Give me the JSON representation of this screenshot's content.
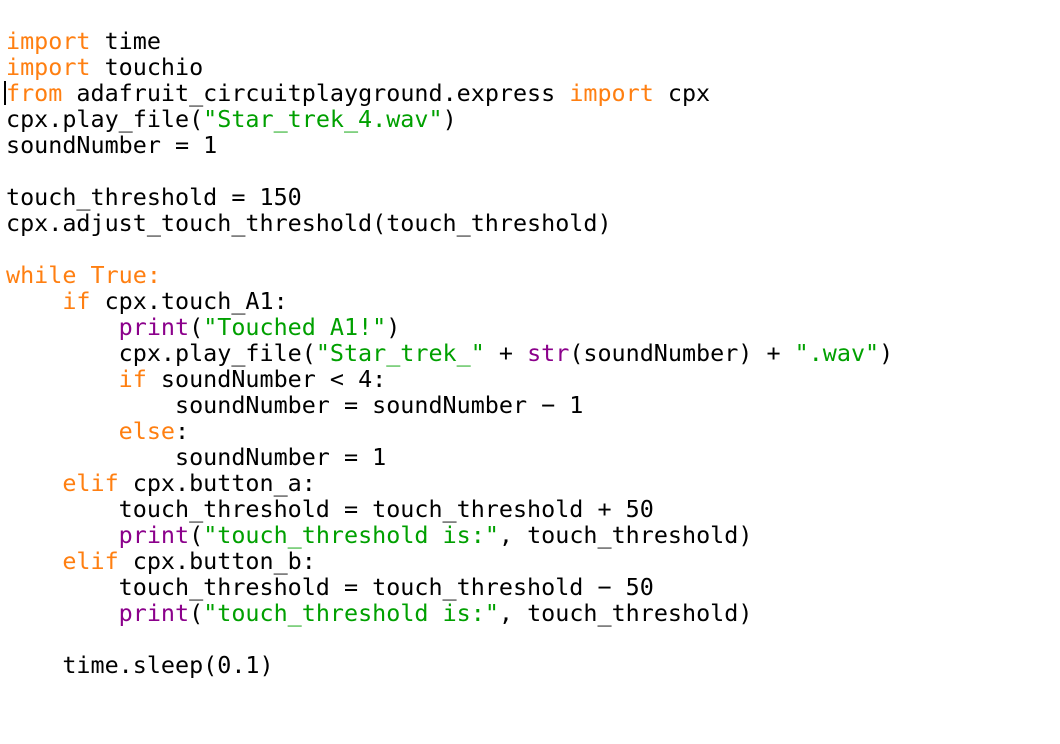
{
  "editor": {
    "language": "python",
    "caret_line_index": 2,
    "caret_column": 0,
    "colors": {
      "background": "#ffffff",
      "foreground": "#000000",
      "keyword": "#ff7f11",
      "string": "#00a000",
      "builtin": "#8b008b",
      "caret": "#000000"
    },
    "plain_text": "import time\nimport touchio\nfrom adafruit_circuitplayground.express import cpx\ncpx.play_file(\"Star_trek_4.wav\")\nsoundNumber = 1\n\ntouch_threshold = 150\ncpx.adjust_touch_threshold(touch_threshold)\n\nwhile True:\n    if cpx.touch_A1:\n        print(\"Touched A1!\")\n        cpx.play_file(\"Star_trek_\" + str(soundNumber) + \".wav\")\n        if soundNumber < 4:\n            soundNumber = soundNumber - 1\n        else:\n            soundNumber = 1\n    elif cpx.button_a:\n        touch_threshold = touch_threshold + 50\n        print(\"touch_threshold is:\", touch_threshold)\n    elif cpx.button_b:\n        touch_threshold = touch_threshold - 50\n        print(\"touch_threshold is:\", touch_threshold)\n\n    time.sleep(0.1)\n",
    "lines": [
      {
        "index": 0,
        "tokens": [
          {
            "t": "import",
            "k": "kw"
          },
          {
            "t": " time",
            "k": "plain"
          }
        ]
      },
      {
        "index": 1,
        "tokens": [
          {
            "t": "import",
            "k": "kw"
          },
          {
            "t": " touchio",
            "k": "plain"
          }
        ]
      },
      {
        "index": 2,
        "tokens": [
          {
            "t": "from",
            "k": "kw"
          },
          {
            "t": " adafruit_circuitplayground.express ",
            "k": "plain"
          },
          {
            "t": "import",
            "k": "kw"
          },
          {
            "t": " cpx",
            "k": "plain"
          }
        ]
      },
      {
        "index": 3,
        "tokens": [
          {
            "t": "cpx.play_file(",
            "k": "plain"
          },
          {
            "t": "\"Star_trek_4.wav\"",
            "k": "str"
          },
          {
            "t": ")",
            "k": "plain"
          }
        ]
      },
      {
        "index": 4,
        "tokens": [
          {
            "t": "soundNumber = 1",
            "k": "plain"
          }
        ]
      },
      {
        "index": 5,
        "tokens": []
      },
      {
        "index": 6,
        "tokens": [
          {
            "t": "touch_threshold = 150",
            "k": "plain"
          }
        ]
      },
      {
        "index": 7,
        "tokens": [
          {
            "t": "cpx.adjust_touch_threshold(touch_threshold)",
            "k": "plain"
          }
        ]
      },
      {
        "index": 8,
        "tokens": []
      },
      {
        "index": 9,
        "tokens": [
          {
            "t": "while True",
            "k": "kw"
          },
          {
            "t": ":",
            "k": "kw"
          }
        ]
      },
      {
        "index": 10,
        "tokens": [
          {
            "t": "    ",
            "k": "plain"
          },
          {
            "t": "if",
            "k": "kw"
          },
          {
            "t": " cpx.touch_A1:",
            "k": "plain"
          }
        ]
      },
      {
        "index": 11,
        "tokens": [
          {
            "t": "        ",
            "k": "plain"
          },
          {
            "t": "print",
            "k": "builtin"
          },
          {
            "t": "(",
            "k": "plain"
          },
          {
            "t": "\"Touched A1!\"",
            "k": "str"
          },
          {
            "t": ")",
            "k": "plain"
          }
        ]
      },
      {
        "index": 12,
        "tokens": [
          {
            "t": "        cpx.play_file(",
            "k": "plain"
          },
          {
            "t": "\"Star_trek_\"",
            "k": "str"
          },
          {
            "t": " + ",
            "k": "plain"
          },
          {
            "t": "str",
            "k": "builtin"
          },
          {
            "t": "(soundNumber) + ",
            "k": "plain"
          },
          {
            "t": "\".wav\"",
            "k": "str"
          },
          {
            "t": ")",
            "k": "plain"
          }
        ]
      },
      {
        "index": 13,
        "tokens": [
          {
            "t": "        ",
            "k": "plain"
          },
          {
            "t": "if",
            "k": "kw"
          },
          {
            "t": " soundNumber < 4:",
            "k": "plain"
          }
        ]
      },
      {
        "index": 14,
        "tokens": [
          {
            "t": "            soundNumber = soundNumber − 1",
            "k": "plain"
          }
        ]
      },
      {
        "index": 15,
        "tokens": [
          {
            "t": "        ",
            "k": "plain"
          },
          {
            "t": "else",
            "k": "kw"
          },
          {
            "t": ":",
            "k": "plain"
          }
        ]
      },
      {
        "index": 16,
        "tokens": [
          {
            "t": "            soundNumber = 1",
            "k": "plain"
          }
        ]
      },
      {
        "index": 17,
        "tokens": [
          {
            "t": "    ",
            "k": "plain"
          },
          {
            "t": "elif",
            "k": "kw"
          },
          {
            "t": " cpx.button_a:",
            "k": "plain"
          }
        ]
      },
      {
        "index": 18,
        "tokens": [
          {
            "t": "        touch_threshold = touch_threshold + 50",
            "k": "plain"
          }
        ]
      },
      {
        "index": 19,
        "tokens": [
          {
            "t": "        ",
            "k": "plain"
          },
          {
            "t": "print",
            "k": "builtin"
          },
          {
            "t": "(",
            "k": "plain"
          },
          {
            "t": "\"touch_threshold is:\"",
            "k": "str"
          },
          {
            "t": ", touch_threshold)",
            "k": "plain"
          }
        ]
      },
      {
        "index": 20,
        "tokens": [
          {
            "t": "    ",
            "k": "plain"
          },
          {
            "t": "elif",
            "k": "kw"
          },
          {
            "t": " cpx.button_b:",
            "k": "plain"
          }
        ]
      },
      {
        "index": 21,
        "tokens": [
          {
            "t": "        touch_threshold = touch_threshold − 50",
            "k": "plain"
          }
        ]
      },
      {
        "index": 22,
        "tokens": [
          {
            "t": "        ",
            "k": "plain"
          },
          {
            "t": "print",
            "k": "builtin"
          },
          {
            "t": "(",
            "k": "plain"
          },
          {
            "t": "\"touch_threshold is:\"",
            "k": "str"
          },
          {
            "t": ", touch_threshold)",
            "k": "plain"
          }
        ]
      },
      {
        "index": 23,
        "tokens": []
      },
      {
        "index": 24,
        "tokens": [
          {
            "t": "    time.sleep(0.1)",
            "k": "plain"
          }
        ]
      },
      {
        "index": 25,
        "tokens": []
      },
      {
        "index": 26,
        "tokens": []
      }
    ]
  }
}
